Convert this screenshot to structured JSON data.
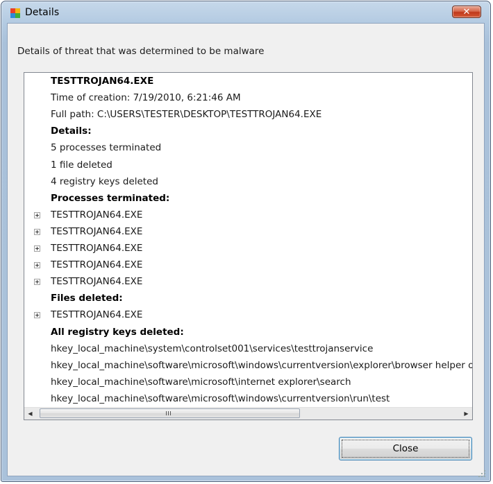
{
  "window": {
    "title": "Details",
    "icon": "avg-logo-icon",
    "close_glyph": "✕"
  },
  "description": "Details of threat that was determined to be malware",
  "details_list": [
    {
      "text": "TESTTROJAN64.EXE",
      "bold": true,
      "expandable": false
    },
    {
      "text": "Time of creation: 7/19/2010, 6:21:46 AM",
      "bold": false,
      "expandable": false
    },
    {
      "text": "Full path: C:\\USERS\\TESTER\\DESKTOP\\TESTTROJAN64.EXE",
      "bold": false,
      "expandable": false
    },
    {
      "text": "Details:",
      "bold": true,
      "expandable": false
    },
    {
      "text": "5 processes terminated",
      "bold": false,
      "expandable": false
    },
    {
      "text": "1 file deleted",
      "bold": false,
      "expandable": false
    },
    {
      "text": "4 registry keys deleted",
      "bold": false,
      "expandable": false
    },
    {
      "text": "Processes terminated:",
      "bold": true,
      "expandable": false
    },
    {
      "text": "TESTTROJAN64.EXE",
      "bold": false,
      "expandable": true
    },
    {
      "text": "TESTTROJAN64.EXE",
      "bold": false,
      "expandable": true
    },
    {
      "text": "TESTTROJAN64.EXE",
      "bold": false,
      "expandable": true
    },
    {
      "text": "TESTTROJAN64.EXE",
      "bold": false,
      "expandable": true
    },
    {
      "text": "TESTTROJAN64.EXE",
      "bold": false,
      "expandable": true
    },
    {
      "text": "Files deleted:",
      "bold": true,
      "expandable": false
    },
    {
      "text": "TESTTROJAN64.EXE",
      "bold": false,
      "expandable": true
    },
    {
      "text": "All registry keys deleted:",
      "bold": true,
      "expandable": false
    },
    {
      "text": "hkey_local_machine\\system\\controlset001\\services\\testtrojanservice",
      "bold": false,
      "expandable": false
    },
    {
      "text": "hkey_local_machine\\software\\microsoft\\windows\\currentversion\\explorer\\browser helper objects",
      "bold": false,
      "expandable": false
    },
    {
      "text": "hkey_local_machine\\software\\microsoft\\internet explorer\\search",
      "bold": false,
      "expandable": false
    },
    {
      "text": "hkey_local_machine\\software\\microsoft\\windows\\currentversion\\run\\test",
      "bold": false,
      "expandable": false
    }
  ],
  "scrollbar": {
    "left_arrow": "◀",
    "right_arrow": "▶"
  },
  "buttons": {
    "close_label": "Close"
  },
  "colors": {
    "titlebar_close": "#c0391b",
    "button_border": "#3c7fb1"
  }
}
